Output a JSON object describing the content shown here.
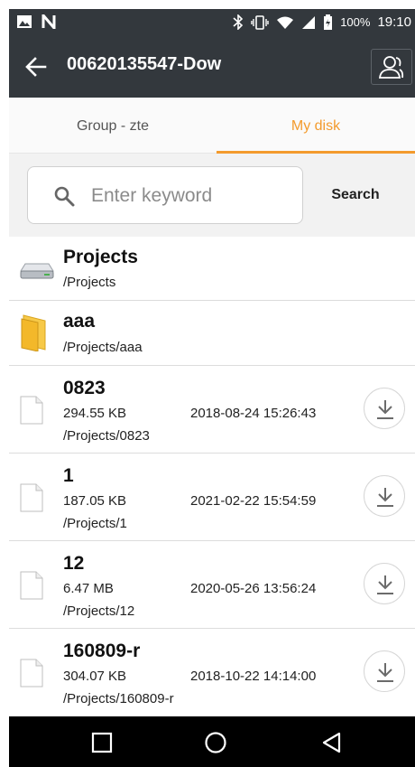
{
  "status_bar": {
    "battery": "100%",
    "time": "19:10"
  },
  "app_bar": {
    "title": "00620135547-Dow"
  },
  "tabs": [
    {
      "label": "Group - zte",
      "selected": false
    },
    {
      "label": "My disk",
      "selected": true
    }
  ],
  "search": {
    "placeholder": "Enter keyword",
    "value": "",
    "button_label": "Search"
  },
  "list": {
    "items": [
      {
        "type": "disk",
        "name": "Projects",
        "path": "/Projects"
      },
      {
        "type": "folder",
        "name": "aaa",
        "path": "/Projects/aaa"
      },
      {
        "type": "file",
        "name": "0823",
        "size": "294.55 KB",
        "date": "2018-08-24 15:26:43",
        "path": "/Projects/0823"
      },
      {
        "type": "file",
        "name": "1",
        "size": "187.05 KB",
        "date": "2021-02-22 15:54:59",
        "path": "/Projects/1"
      },
      {
        "type": "file",
        "name": "12",
        "size": "6.47 MB",
        "date": "2020-05-26 13:56:24",
        "path": "/Projects/12"
      },
      {
        "type": "file",
        "name": "160809-r",
        "size": "304.07 KB",
        "date": "2018-10-22 14:14:00",
        "path": "/Projects/160809-r"
      }
    ]
  },
  "colors": {
    "accent": "#f39b2d",
    "header": "#33383d"
  },
  "icons": [
    "picture-icon",
    "n-icon",
    "bluetooth-icon",
    "vibrate-icon",
    "wifi-icon",
    "signal-icon",
    "battery-icon",
    "back-arrow-icon",
    "users-icon",
    "search-icon",
    "disk-icon",
    "folder-icon",
    "file-icon",
    "download-icon",
    "nav-recent-icon",
    "nav-home-icon",
    "nav-back-icon"
  ]
}
